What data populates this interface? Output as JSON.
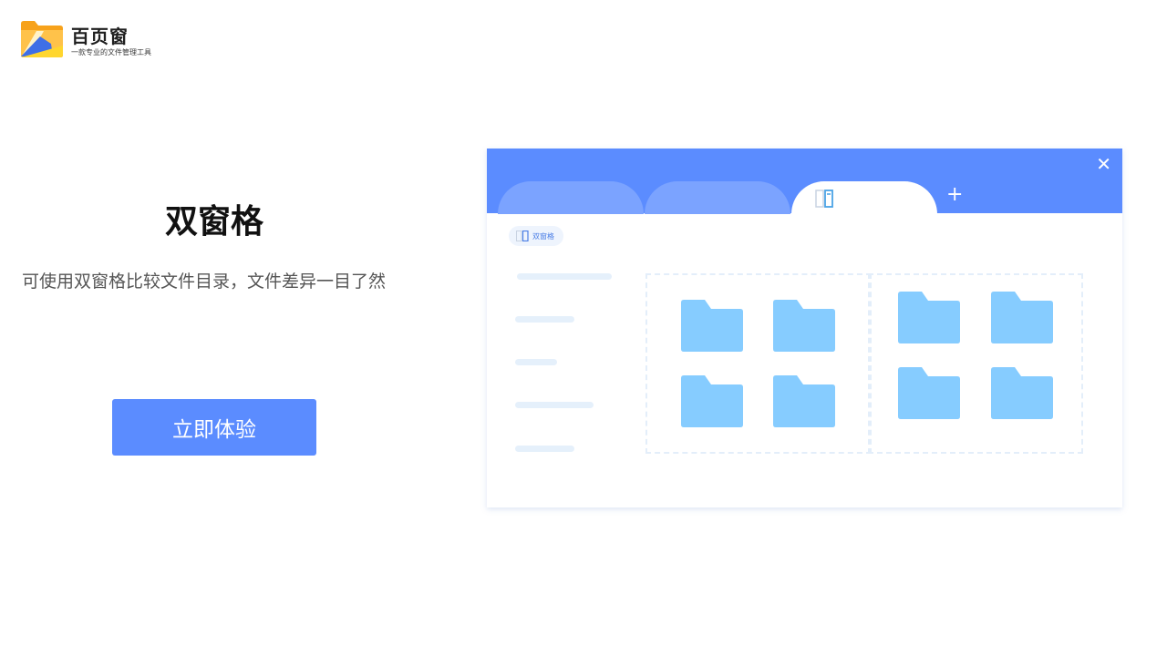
{
  "brand": {
    "name": "百页窗",
    "tagline": "一款专业的文件管理工具"
  },
  "feature": {
    "title": "双窗格",
    "description": "可使用双窗格比较文件目录，文件差异一目了然",
    "cta_label": "立即体验"
  },
  "illustration": {
    "active_tab_icon": "dual-pane-icon",
    "pill_label": "双窗格",
    "plus_symbol": "+",
    "close_symbol": "✕"
  },
  "colors": {
    "accent": "#5b8cff",
    "tab_inactive": "#7ba3ff",
    "folder": "#86ccff",
    "placeholder": "#e5f0fb"
  }
}
